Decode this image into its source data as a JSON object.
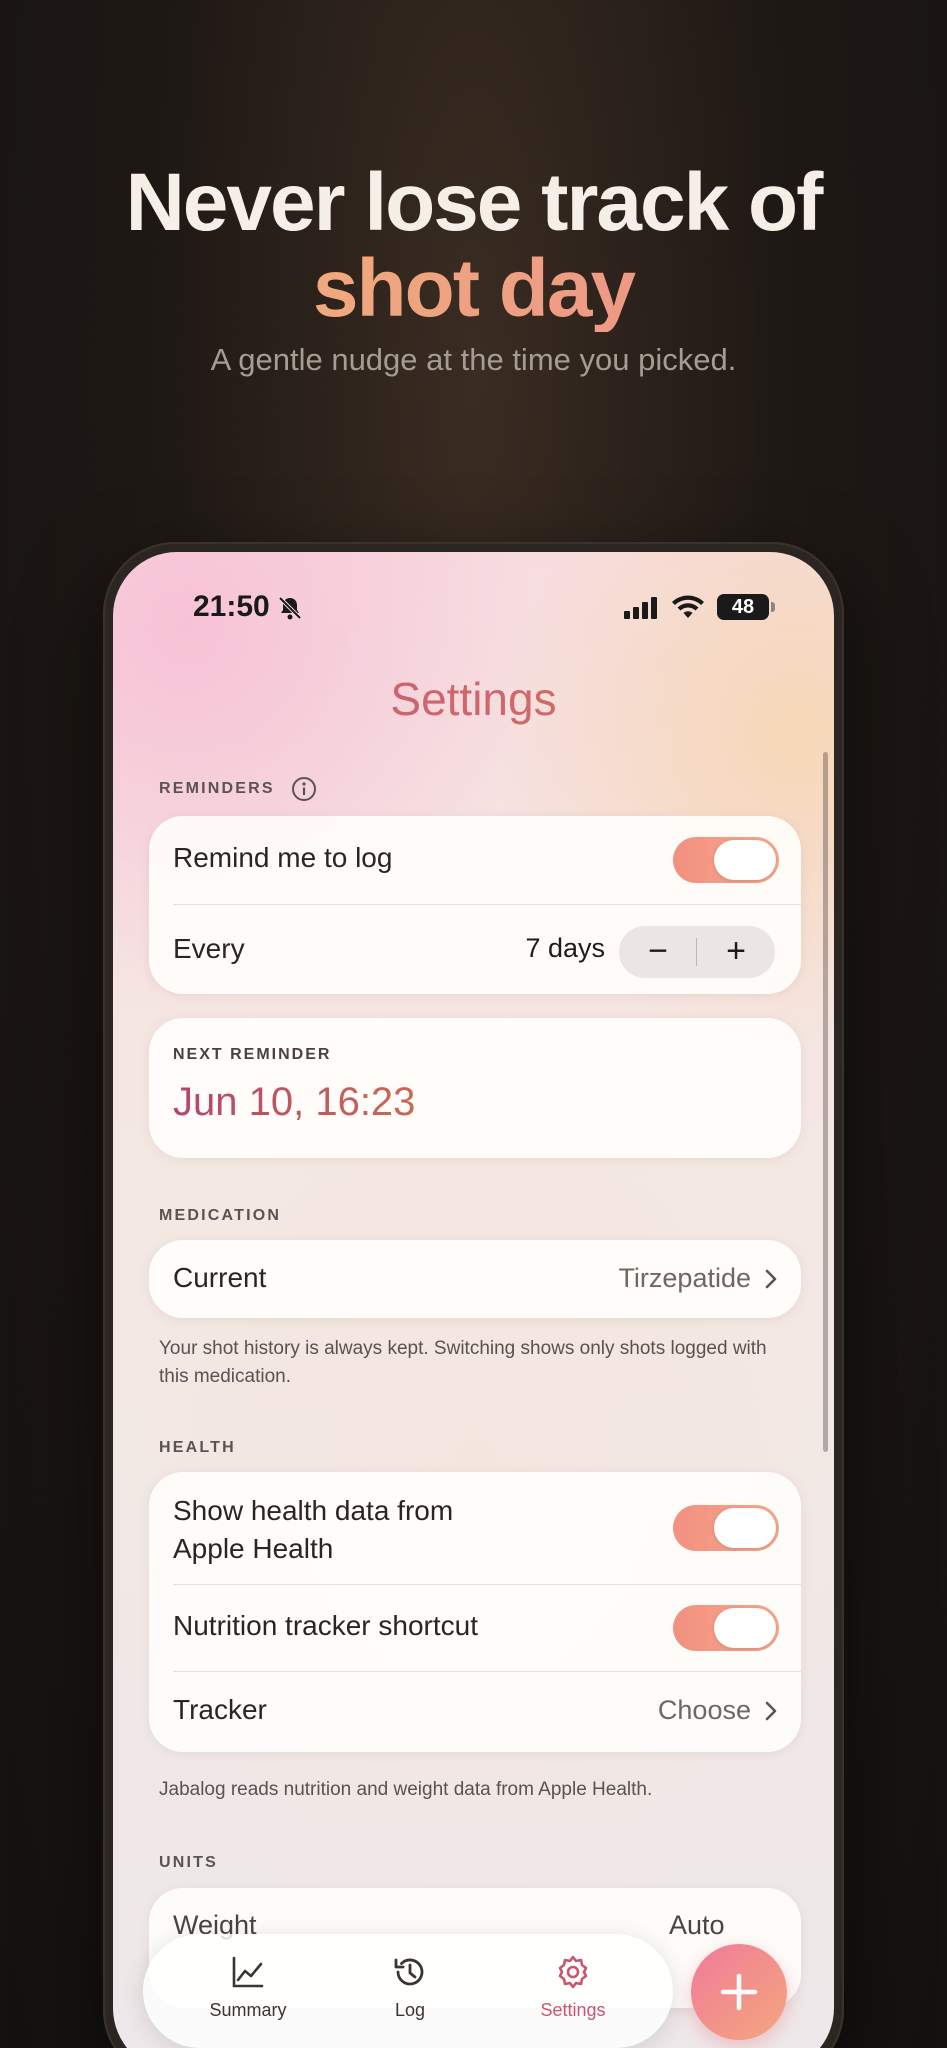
{
  "promo": {
    "headline_line1": "Never lose track of",
    "headline_line2": "shot day",
    "subhead": "A gentle nudge at the time you picked."
  },
  "statusbar": {
    "time": "21:50",
    "battery": "48",
    "icons": [
      "bell-slash-icon",
      "cellular-signal-icon",
      "wifi-icon",
      "battery-icon"
    ]
  },
  "screen": {
    "title": "Settings",
    "reminders": {
      "section_label": "REMINDERS",
      "remind_label": "Remind me to log",
      "remind_on": true,
      "every_label": "Every",
      "every_value": "7 days",
      "minus": "−",
      "plus": "+"
    },
    "next_reminder": {
      "label": "NEXT REMINDER",
      "value": "Jun 10, 16:23"
    },
    "medication": {
      "section_label": "MEDICATION",
      "current_label": "Current",
      "current_value": "Tirzepatide",
      "footnote": "Your shot history is always kept. Switching shows only shots logged with this medication."
    },
    "health": {
      "section_label": "HEALTH",
      "apple_health_label_line1": "Show health data from",
      "apple_health_label_line2": "Apple Health",
      "apple_health_on": true,
      "nutrition_label": "Nutrition tracker shortcut",
      "nutrition_on": true,
      "tracker_label": "Tracker",
      "tracker_value": "Choose",
      "footnote": "Jabalog reads nutrition and weight data from Apple Health."
    },
    "units": {
      "section_label": "UNITS",
      "weight_label": "Weight",
      "weight_value": "Auto"
    }
  },
  "tabbar": {
    "tabs": [
      {
        "label": "Summary",
        "icon": "chart-line-icon",
        "active": false
      },
      {
        "label": "Log",
        "icon": "history-icon",
        "active": false
      },
      {
        "label": "Settings",
        "icon": "gear-icon",
        "active": true
      }
    ],
    "fab_icon": "plus-icon"
  },
  "colors": {
    "accent_start": "#c4567a",
    "accent_end": "#d8775f",
    "toggle": "#f29080",
    "headline_accent": "#f3b877"
  }
}
